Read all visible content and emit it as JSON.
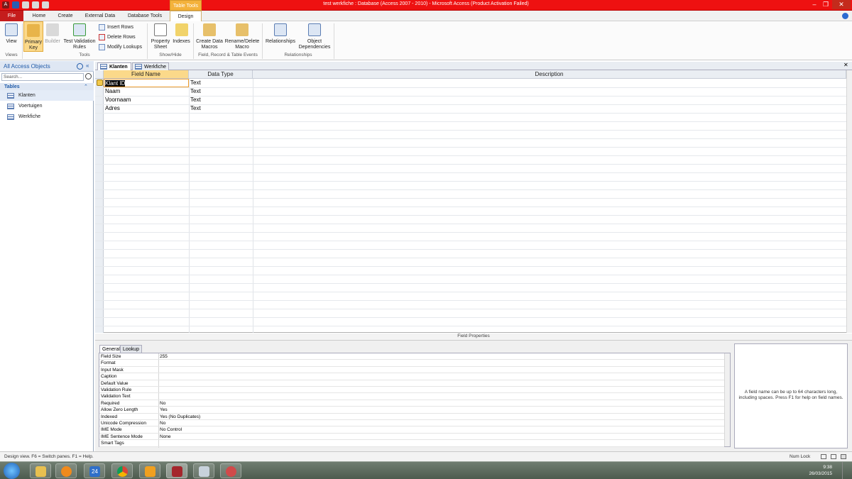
{
  "window": {
    "title": "test werkfiche : Database (Access 2007 - 2010) - Microsoft Access (Product Activation Failed)",
    "context_tab_label": "Table Tools",
    "minimize": "–",
    "restore": "❐",
    "close": "✕"
  },
  "ribbon_tabs": [
    "File",
    "Home",
    "Create",
    "External Data",
    "Database Tools",
    "Design"
  ],
  "ribbon": {
    "view_label": "View",
    "primary_key_label": "Primary Key",
    "builder_label": "Builder",
    "test_validation_label": "Test Validation Rules",
    "insert_rows": "Insert Rows",
    "delete_rows": "Delete Rows",
    "modify_lookups": "Modify Lookups",
    "property_sheet_label": "Property Sheet",
    "indexes_label": "Indexes",
    "create_data_macros_label": "Create Data Macros",
    "rename_delete_macro_label": "Rename/Delete Macro",
    "relationships_label": "Relationships",
    "object_dependencies_label": "Object Dependencies",
    "groups": {
      "views": "Views",
      "tools": "Tools",
      "show_hide": "Show/Hide",
      "field_record": "Field, Record & Table Events",
      "relationships": "Relationships"
    }
  },
  "nav": {
    "header": "All Access Objects",
    "search_placeholder": "Search...",
    "section": "Tables",
    "items": [
      "Klanten",
      "Voertuigen",
      "Werkfiche"
    ]
  },
  "doc_tabs": [
    "Klanten",
    "Werkfiche"
  ],
  "grid": {
    "headers": {
      "field_name": "Field Name",
      "data_type": "Data Type",
      "description": "Description"
    },
    "rows": [
      {
        "field": "Klant ID",
        "type": "Text"
      },
      {
        "field": "Naam",
        "type": "Text"
      },
      {
        "field": "Voornaam",
        "type": "Text"
      },
      {
        "field": "Adres",
        "type": "Text"
      }
    ]
  },
  "field_properties": {
    "label": "Field Properties",
    "tabs": [
      "General",
      "Lookup"
    ],
    "rows": [
      {
        "label": "Field Size",
        "value": "255"
      },
      {
        "label": "Format",
        "value": ""
      },
      {
        "label": "Input Mask",
        "value": ""
      },
      {
        "label": "Caption",
        "value": ""
      },
      {
        "label": "Default Value",
        "value": ""
      },
      {
        "label": "Validation Rule",
        "value": ""
      },
      {
        "label": "Validation Text",
        "value": ""
      },
      {
        "label": "Required",
        "value": "No"
      },
      {
        "label": "Allow Zero Length",
        "value": "Yes"
      },
      {
        "label": "Indexed",
        "value": "Yes (No Duplicates)"
      },
      {
        "label": "Unicode Compression",
        "value": "No"
      },
      {
        "label": "IME Mode",
        "value": "No Control"
      },
      {
        "label": "IME Sentence Mode",
        "value": "None"
      },
      {
        "label": "Smart Tags",
        "value": ""
      }
    ],
    "help_text": "A field name can be up to 64 characters long, including spaces. Press F1 for help on field names."
  },
  "status": {
    "left": "Design view.  F6 = Switch panes.  F1 = Help.",
    "right": "Num Lock"
  },
  "taskbar": {
    "time": "9:38",
    "date": "26/03/2015",
    "calendar_badge": "24"
  },
  "colors": {
    "title_red": "#ee1111",
    "file_tab": "#c51d1d",
    "context_orange": "#f4b23c",
    "accent_blue": "#1f5aa8"
  }
}
